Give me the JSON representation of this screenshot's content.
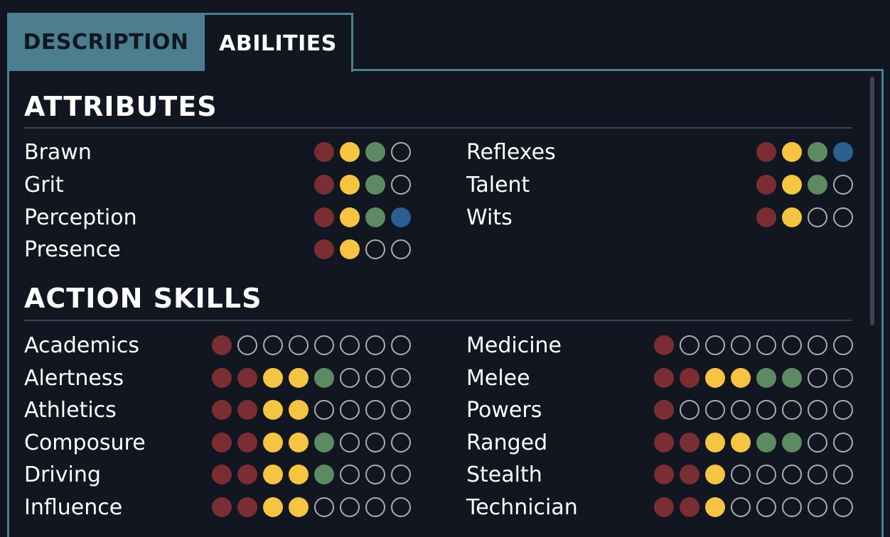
{
  "tabs": [
    {
      "label": "DESCRIPTION",
      "active": false
    },
    {
      "label": "ABILITIES",
      "active": true
    }
  ],
  "colors": {
    "level1": "#7a2e34",
    "level2": "#f5c542",
    "level3": "#5d8a62",
    "level4": "#2b5f91",
    "empty": "#a9adb5",
    "accent": "#4b7f8f"
  },
  "attributes": {
    "title": "ATTRIBUTES",
    "max": 4,
    "items": [
      {
        "label": "Brawn",
        "value": 3
      },
      {
        "label": "Grit",
        "value": 3
      },
      {
        "label": "Perception",
        "value": 4
      },
      {
        "label": "Presence",
        "value": 2
      },
      {
        "label": "Reflexes",
        "value": 4
      },
      {
        "label": "Talent",
        "value": 3
      },
      {
        "label": "Wits",
        "value": 2
      }
    ]
  },
  "action_skills": {
    "title": "ACTION SKILLS",
    "max": 8,
    "items": [
      {
        "label": "Academics",
        "value": 1
      },
      {
        "label": "Alertness",
        "value": 5
      },
      {
        "label": "Athletics",
        "value": 4
      },
      {
        "label": "Composure",
        "value": 5
      },
      {
        "label": "Driving",
        "value": 5
      },
      {
        "label": "Influence",
        "value": 4
      },
      {
        "label": "Medicine",
        "value": 1
      },
      {
        "label": "Melee",
        "value": 6
      },
      {
        "label": "Powers",
        "value": 1
      },
      {
        "label": "Ranged",
        "value": 6
      },
      {
        "label": "Stealth",
        "value": 3
      },
      {
        "label": "Technician",
        "value": 3
      }
    ]
  }
}
